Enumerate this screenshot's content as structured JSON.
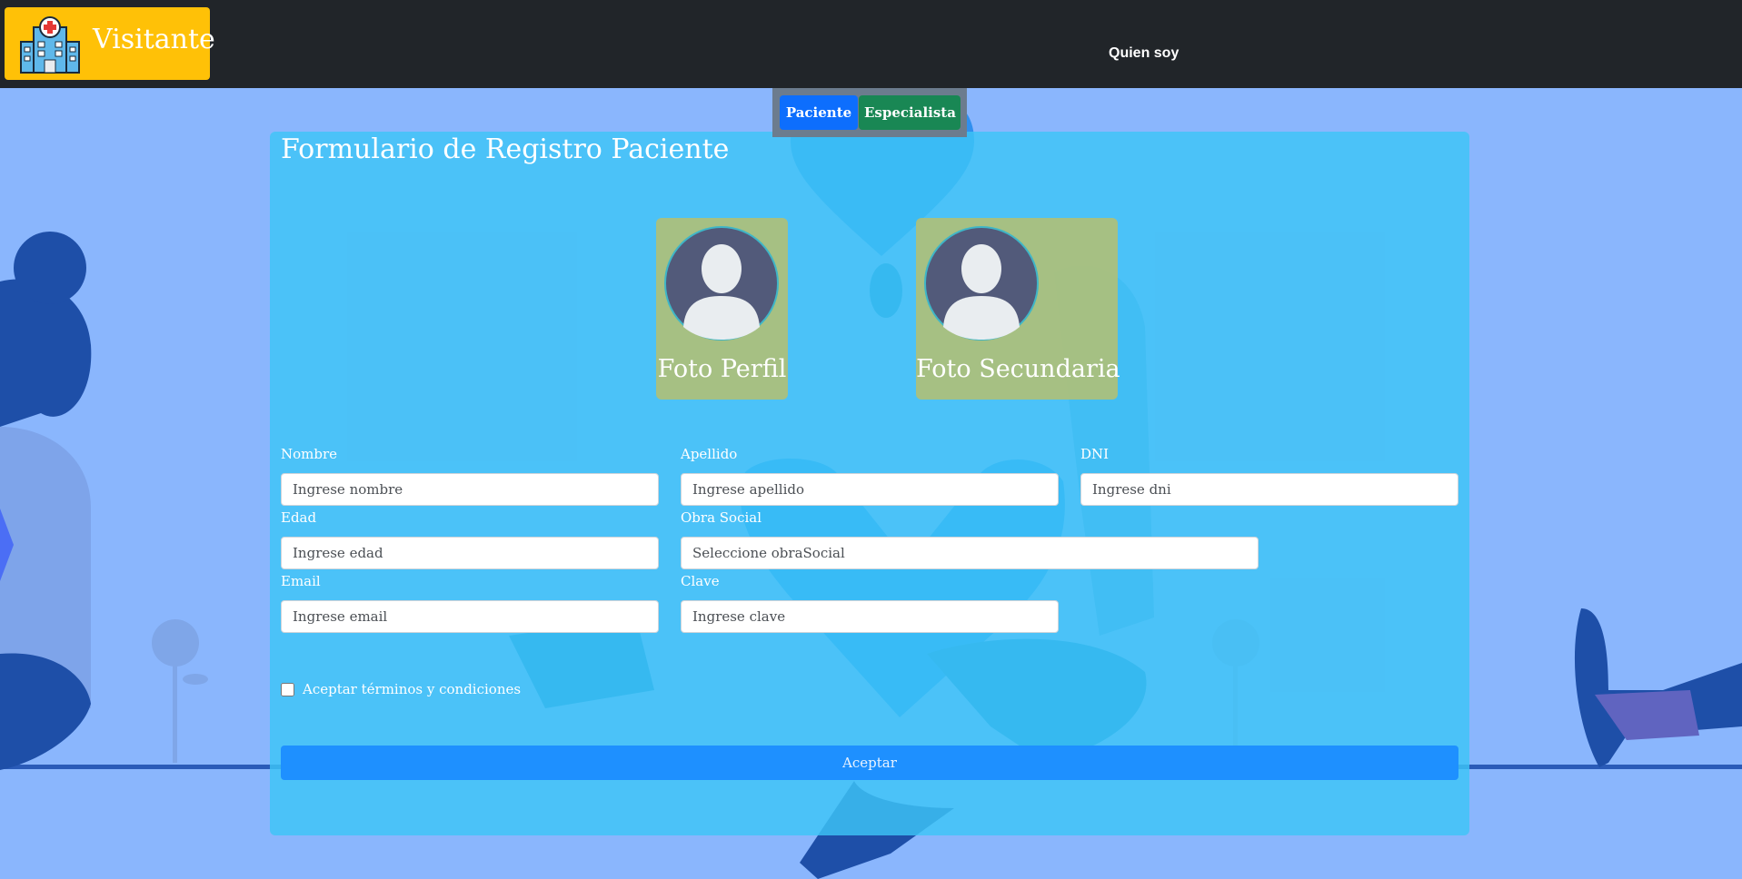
{
  "navbar": {
    "brand_text": "Visitante",
    "brand_color": "#ffc107",
    "brand_icon": "hospital-icon",
    "links": [
      {
        "label": "Quien soy"
      }
    ]
  },
  "role_switch": {
    "paciente_label": "Paciente",
    "especialista_label": "Especialista"
  },
  "form": {
    "title": "Formulario de Registro Paciente",
    "photos": [
      {
        "label": "Foto Perfil",
        "icon": "user-avatar-icon"
      },
      {
        "label": "Foto Secundaria",
        "icon": "user-avatar-icon"
      }
    ],
    "fields": {
      "nombre": {
        "label": "Nombre",
        "placeholder": "Ingrese nombre"
      },
      "apellido": {
        "label": "Apellido",
        "placeholder": "Ingrese apellido"
      },
      "dni": {
        "label": "DNI",
        "placeholder": "Ingrese dni"
      },
      "edad": {
        "label": "Edad",
        "placeholder": "Ingrese edad"
      },
      "obra_social": {
        "label": "Obra Social",
        "placeholder": "Seleccione obraSocial"
      },
      "email": {
        "label": "Email",
        "placeholder": "Ingrese email"
      },
      "clave": {
        "label": "Clave",
        "placeholder": "Ingrese clave"
      }
    },
    "terms_label": "Aceptar términos y condiciones",
    "submit_label": "Aceptar"
  },
  "colors": {
    "navbar_bg": "#212529",
    "page_bg": "#8ab6fd",
    "panel_bg": "#3dc4f6",
    "primary": "#0d6efd",
    "success": "#198754"
  }
}
